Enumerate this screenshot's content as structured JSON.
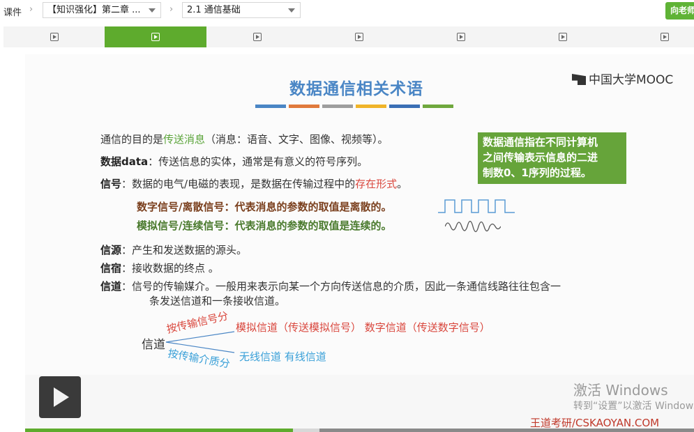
{
  "breadcrumb": {
    "root": "课件",
    "chapter_select": "【知识强化】第二章 ...",
    "section_select": "2.1 通信基础"
  },
  "header": {
    "ask_teacher": "向老师"
  },
  "video_tabs": {
    "count": 7,
    "active_index": 1
  },
  "slide": {
    "title": "数据通信相关术语",
    "logo": "中国大学MOOC",
    "title_bar_colors": [
      "#4a86c5",
      "#e07a3c",
      "#9e9e9e",
      "#f0b429",
      "#3a6fb5",
      "#6fa83d"
    ],
    "line1": {
      "pre": "通信的目的是",
      "hl": "传送消息",
      "post": "（消息：语音、文字、图像、视频等）。"
    },
    "line2": {
      "term": "数据data",
      "text": "：传送信息的实体，通常是有意义的符号序列。"
    },
    "line3": {
      "term": "信号",
      "text": "：数据的电气/电磁的表现，是数据在传输过程中的",
      "hl": "存在形式",
      "post": "。"
    },
    "digital": "数字信号/离散信号：代表消息的参数的取值是离散的。",
    "analog": "模拟信号/连续信号：代表消息的参数的取值是连续的。",
    "source": {
      "term": "信源",
      "text": "：产生和发送数据的源头。"
    },
    "sink": {
      "term": "信宿",
      "text": "：接收数据的终点 。"
    },
    "channel": {
      "term": "信道",
      "text1": "：信号的传输媒介。一般用来表示向某一个方向传送信息的介质，因此一条通信线路往往包含一",
      "text2": "条发送信道和一条接收信道。"
    },
    "green_box": [
      "数据通信指在不同计算机",
      "之间传输表示信息的二进",
      "制数0、1序列的过程。"
    ],
    "diagram": {
      "root": "信道",
      "branch1": "按传输信号分",
      "branch1_items": "模拟信道（传送模拟信号）   数字信道（传送数字信号）",
      "branch2": "按传输介质分",
      "branch2_items": "无线信道    有线信道"
    }
  },
  "watermark": {
    "line1": "激活 Windows",
    "line2": "转到“设置”以激活 Windows。"
  },
  "brand": "王道考研/CSKAOYAN.COM",
  "progress": {
    "played": 0.4,
    "buffered_end": 0.44
  },
  "colors": {
    "accent_green": "#5eab2d",
    "title_blue": "#4a86c5",
    "red": "#d9463c"
  }
}
